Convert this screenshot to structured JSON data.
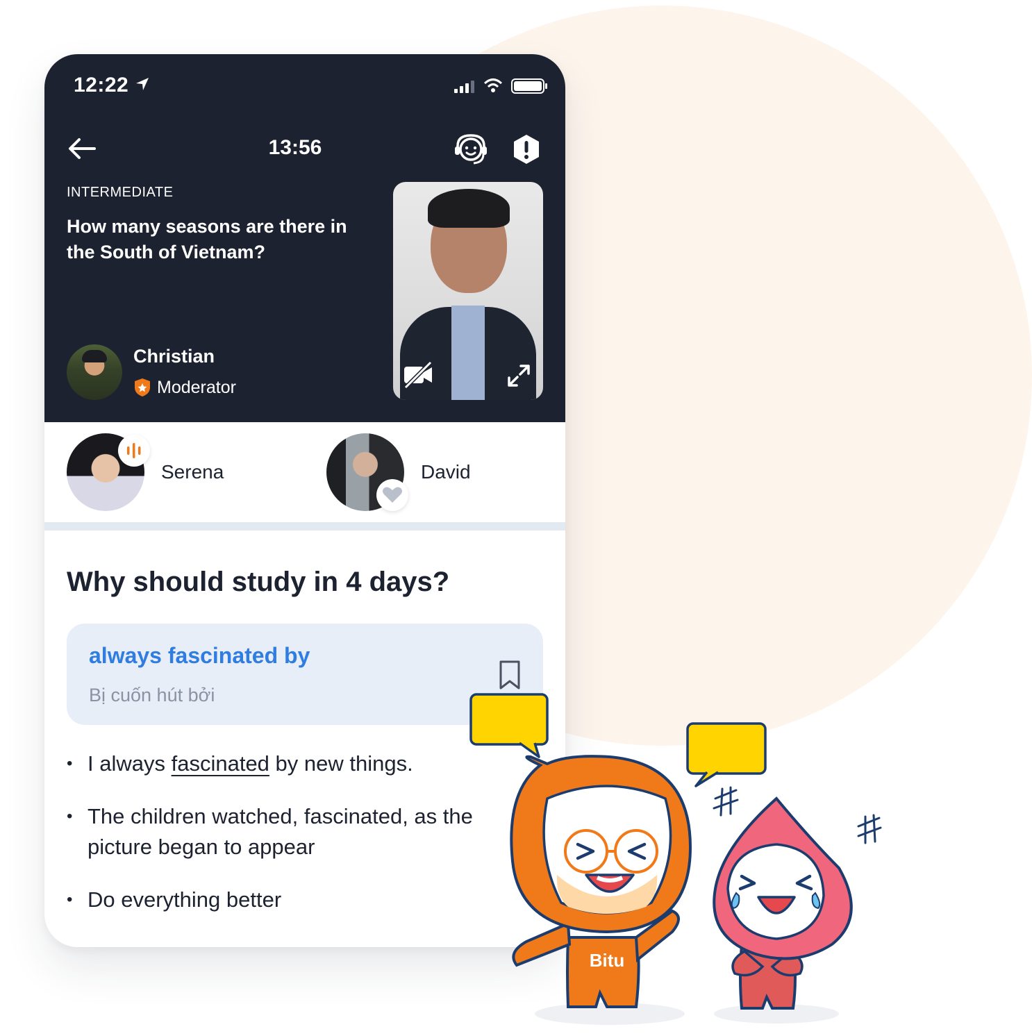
{
  "status_bar": {
    "time": "12:22"
  },
  "header": {
    "timer": "13:56"
  },
  "topic": {
    "level": "INTERMEDIATE",
    "question": "How many seasons are there in the South of Vietnam?"
  },
  "moderator": {
    "name": "Christian",
    "role": "Moderator"
  },
  "participants": [
    {
      "name": "Serena"
    },
    {
      "name": "David"
    }
  ],
  "lesson": {
    "title": "Why should study in 4 days?",
    "vocab": {
      "term": "always fascinated by",
      "translation": "Bị cuốn hút bởi"
    },
    "examples": {
      "e1_before": "I always ",
      "e1_word": "fascinated",
      "e1_after": " by new things.",
      "e2": "The children watched, fascinated, as the picture began to appear",
      "e3": "Do everything better"
    }
  },
  "mascot": {
    "label": "Bitu"
  },
  "colors": {
    "accent": "#2f7de1",
    "dark": "#1c2230",
    "orange": "#f07a1a",
    "pink": "#f0667c",
    "bubble": "#ffd400"
  }
}
